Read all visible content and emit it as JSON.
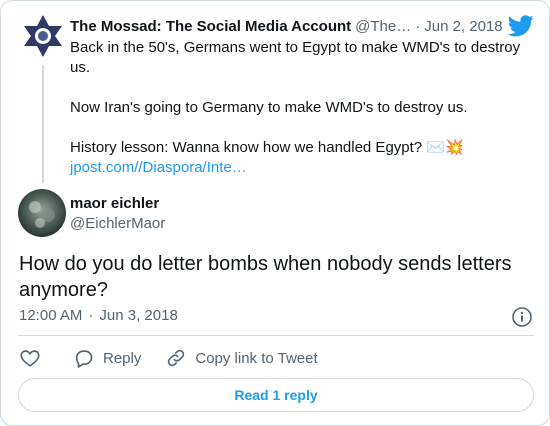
{
  "parent_tweet": {
    "author_name": "The Mossad: The Social Media Account",
    "author_handle": "@The…",
    "date": "Jun 2, 2018",
    "line1": "Back in the 50's, Germans went to Egypt to make WMD's to destroy us.",
    "line2": "Now Iran's going to Germany to make WMD's to destroy us.",
    "line3": "History lesson: Wanna know how we handled Egypt?",
    "emojis": "✉️💥",
    "link": "jpost.com//Diaspora/Inte…"
  },
  "reply": {
    "author_name": "maor eichler",
    "author_handle": "@EichlerMaor",
    "text": "How do you do letter bombs when nobody sends letters anymore?",
    "time": "12:00 AM",
    "date": "Jun 3, 2018"
  },
  "actions": {
    "reply_label": "Reply",
    "copy_label": "Copy link to Tweet"
  },
  "read_button_label": "Read 1 reply",
  "colors": {
    "accent": "#1d9bf0",
    "text": "#0f1419",
    "muted": "#536471",
    "border": "#cfd9de"
  }
}
